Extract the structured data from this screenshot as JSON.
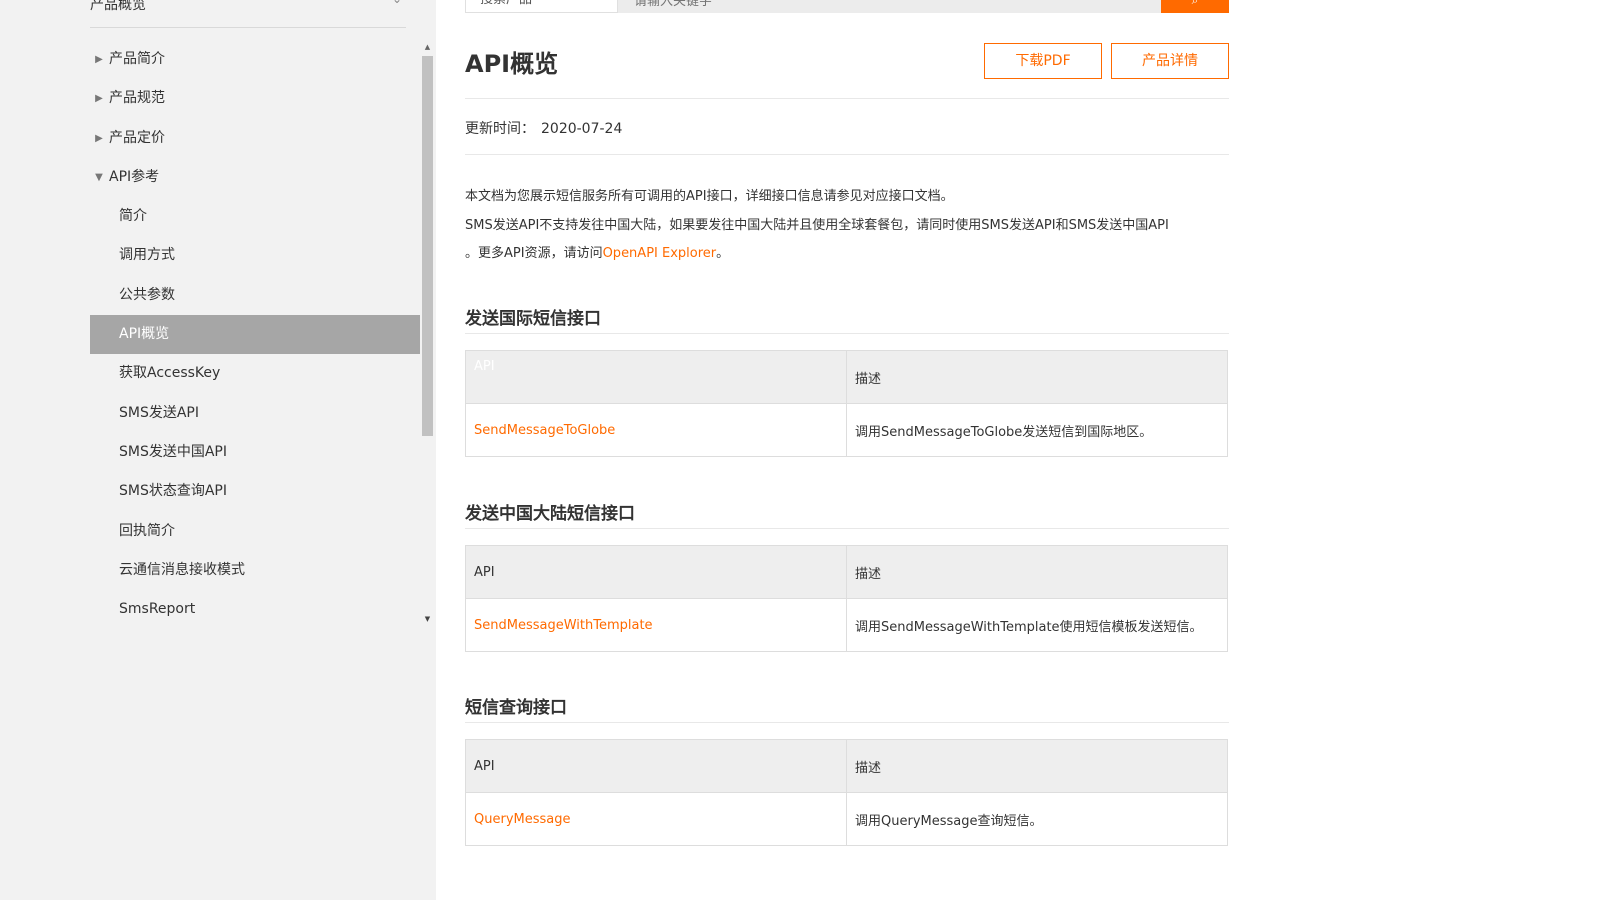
{
  "sidebar": {
    "top_title": "产品概览",
    "items": [
      {
        "label": "产品简介",
        "level": 1,
        "caret": "▶"
      },
      {
        "label": "产品规范",
        "level": 1,
        "caret": "▶"
      },
      {
        "label": "产品定价",
        "level": 1,
        "caret": "▶"
      },
      {
        "label": "API参考",
        "level": 1,
        "caret": "▼"
      },
      {
        "label": "简介",
        "level": 2
      },
      {
        "label": "调用方式",
        "level": 2
      },
      {
        "label": "公共参数",
        "level": 2
      },
      {
        "label": "API概览",
        "level": 2,
        "active": true
      },
      {
        "label": "获取AccessKey",
        "level": 2
      },
      {
        "label": "SMS发送API",
        "level": 2
      },
      {
        "label": "SMS发送中国API",
        "level": 2
      },
      {
        "label": "SMS状态查询API",
        "level": 2
      },
      {
        "label": "回执简介",
        "level": 2
      },
      {
        "label": "云通信消息接收模式",
        "level": 2
      },
      {
        "label": "SmsReport",
        "level": 2
      }
    ]
  },
  "search": {
    "scope": "搜索产品",
    "placeholder": "请输入关键字"
  },
  "page": {
    "title": "API概览",
    "download_pdf": "下载PDF",
    "product_detail": "产品详情",
    "updated_label": "更新时间：",
    "updated_value": "2020-07-24",
    "intro_line1": "本文档为您展示短信服务所有可调用的API接口，详细接口信息请参见对应接口文档。",
    "intro_line2": "SMS发送API不支持发往中国大陆，如果要发往中国大陆并且使用全球套餐包，请同时使用SMS发送API和SMS发送中国API",
    "intro_line3_prefix": "。更多API资源，请访问",
    "intro_link": "OpenAPI Explorer",
    "intro_line3_suffix": "。"
  },
  "sections": [
    {
      "title": "发送国际短信接口",
      "col_api": "API",
      "col_desc": "描述",
      "row": {
        "api": "SendMessageToGlobe",
        "desc": "调用SendMessageToGlobe发送短信到国际地区。"
      }
    },
    {
      "title": "发送中国大陆短信接口",
      "col_api": "API",
      "col_desc": "描述",
      "row": {
        "api": "SendMessageWithTemplate",
        "desc": "调用SendMessageWithTemplate使用短信模板发送短信。"
      }
    },
    {
      "title": "短信查询接口",
      "col_api": "API",
      "col_desc": "描述",
      "row": {
        "api": "QueryMessage",
        "desc": "调用QueryMessage查询短信。"
      }
    }
  ],
  "colors": {
    "accent": "#ff6a00",
    "sidebar_bg": "#f2f2f2",
    "active_item_bg": "#a6a6a6"
  },
  "icons": {
    "search": "search-icon",
    "collapsed": "caret-right-icon",
    "expanded": "caret-down-icon"
  }
}
